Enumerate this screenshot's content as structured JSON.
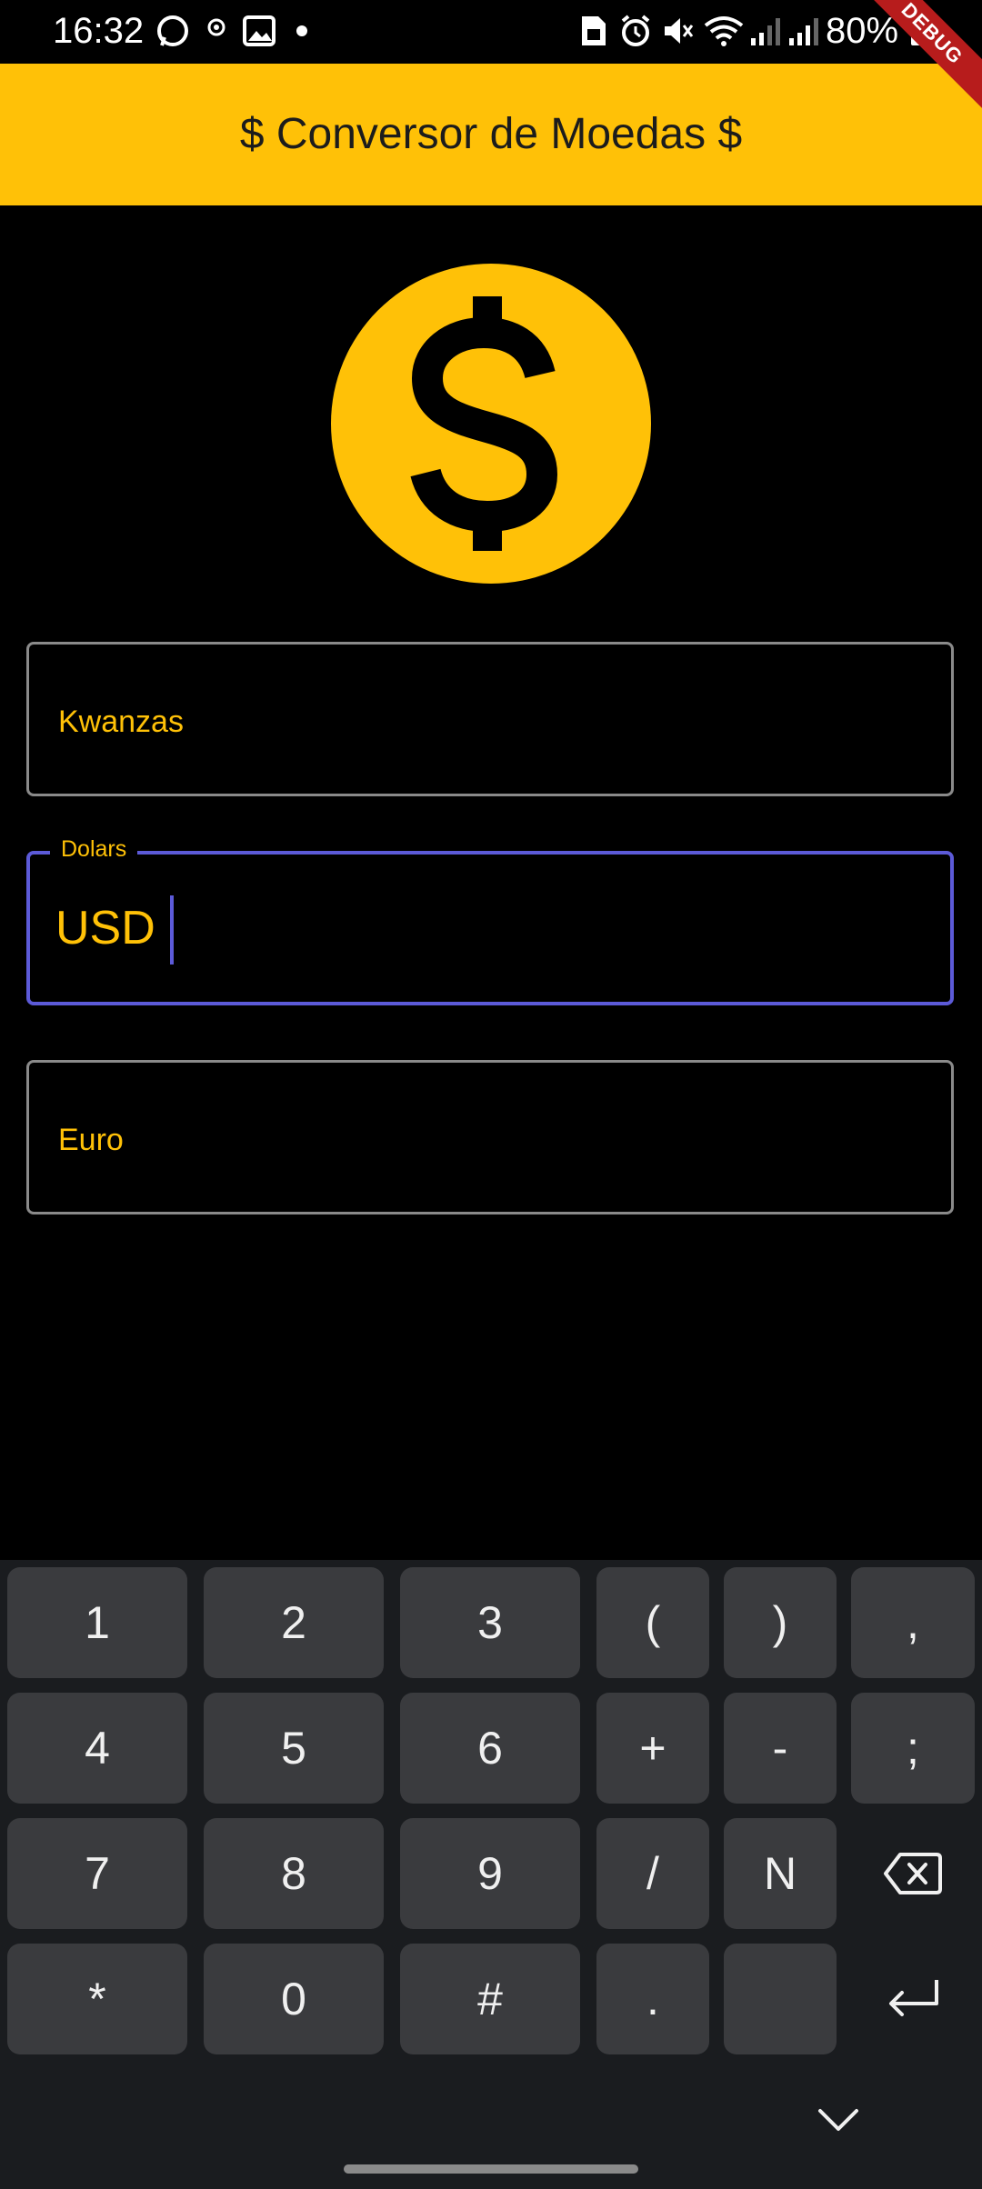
{
  "status": {
    "time": "16:32",
    "battery": "80%"
  },
  "app": {
    "title": "$ Conversor de Moedas $",
    "debug_label": "DEBUG"
  },
  "fields": {
    "kwanzas": {
      "label": "Kwanzas"
    },
    "dolars": {
      "label": "Dolars",
      "value": "USD"
    },
    "euro": {
      "label": "Euro"
    }
  },
  "keyboard": {
    "row1": [
      "1",
      "2",
      "3",
      "(",
      ")",
      ","
    ],
    "row2": [
      "4",
      "5",
      "6",
      "+",
      "-",
      ";"
    ],
    "row3": [
      "7",
      "8",
      "9",
      "/",
      "N"
    ],
    "row4": [
      "*",
      "0",
      "#",
      ".",
      ""
    ]
  },
  "colors": {
    "accent": "#FFC107",
    "focus": "#5C5AD8",
    "background": "#000000",
    "debug": "#B71C1C"
  }
}
